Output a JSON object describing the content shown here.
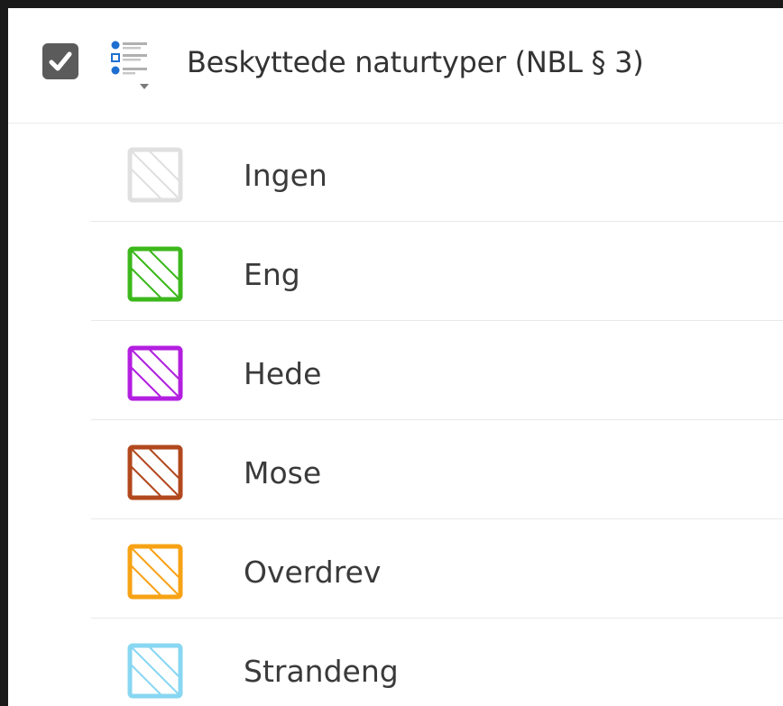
{
  "layer": {
    "checked": true,
    "icon": "legend-list-icon",
    "title": "Beskyttede naturtyper (NBL § 3)"
  },
  "legend": {
    "items": [
      {
        "label": "Ingen",
        "color": "#e0e0e0",
        "icon": "hatched-square-icon"
      },
      {
        "label": "Eng",
        "color": "#3cb81c",
        "icon": "hatched-square-icon"
      },
      {
        "label": "Hede",
        "color": "#b31fe0",
        "icon": "hatched-square-icon"
      },
      {
        "label": "Mose",
        "color": "#b2481d",
        "icon": "hatched-square-icon"
      },
      {
        "label": "Overdrev",
        "color": "#f7a214",
        "icon": "hatched-square-icon"
      },
      {
        "label": "Strandeng",
        "color": "#88d7f2",
        "icon": "hatched-square-icon"
      }
    ]
  }
}
